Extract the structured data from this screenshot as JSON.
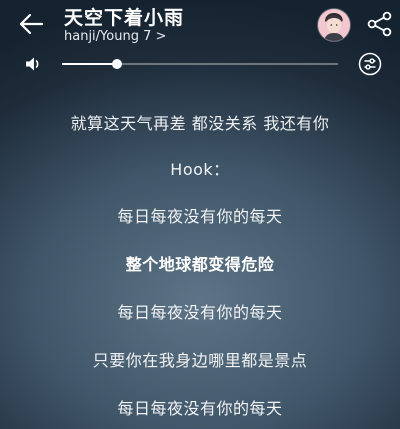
{
  "header": {
    "title": "天空下着小雨",
    "artist_label": "hanji/Young 7 >"
  },
  "icons": {
    "back": "back-arrow-icon",
    "avatar": "singer-avatar",
    "share": "share-icon",
    "volume": "volume-icon",
    "equalizer": "equalizer-icon"
  },
  "volume": {
    "level_fraction": 0.2
  },
  "lyrics": [
    {
      "text": "就算这天气再差 都没关系 我还有你",
      "current": false
    },
    {
      "text": "Hook：",
      "current": false
    },
    {
      "text": "每日每夜没有你的每天",
      "current": false
    },
    {
      "text": "整个地球都变得危险",
      "current": true
    },
    {
      "text": "每日每夜没有你的每天",
      "current": false
    },
    {
      "text": "只要你在我身边哪里都是景点",
      "current": false
    },
    {
      "text": "每日每夜没有你的每天",
      "current": false
    }
  ],
  "colors": {
    "text": "#ffffff",
    "background_dark": "#152230",
    "background_light": "#5d7487",
    "avatar_bg": "#f3c7cf"
  }
}
